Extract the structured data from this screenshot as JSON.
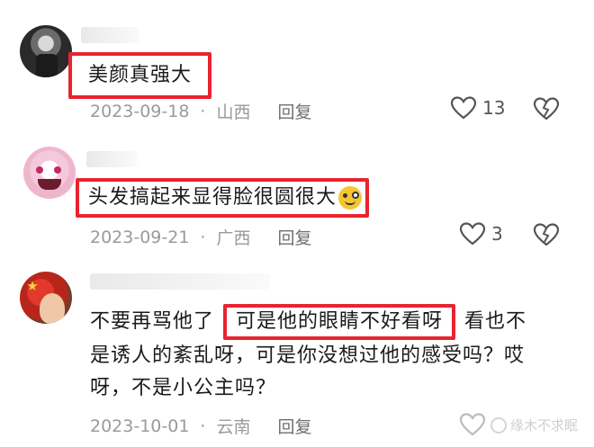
{
  "comments": [
    {
      "text": "美颜真强大",
      "date": "2023-09-18",
      "location": "山西",
      "reply_label": "回复",
      "likes": "13"
    },
    {
      "text": "头发搞起来显得脸很圆很大",
      "emoji": "😜",
      "date": "2023-09-21",
      "location": "广西",
      "reply_label": "回复",
      "likes": "3"
    },
    {
      "text_before": "不要再骂他了",
      "text_highlight": "可是他的眼睛不好看呀",
      "text_after_1": "看也不",
      "text_line2": "是诱人的紊乱呀，可是你没想过他的感受吗？哎",
      "text_line3": "呀，不是小公主吗？",
      "date": "2023-10-01",
      "location": "云南",
      "reply_label": "回复"
    }
  ],
  "separator": "·",
  "watermark": "缘木不求眠",
  "colors": {
    "highlight": "#e8242f",
    "meta": "#9a9a9a"
  },
  "icons": [
    "heart-outline-icon",
    "broken-heart-icon"
  ]
}
